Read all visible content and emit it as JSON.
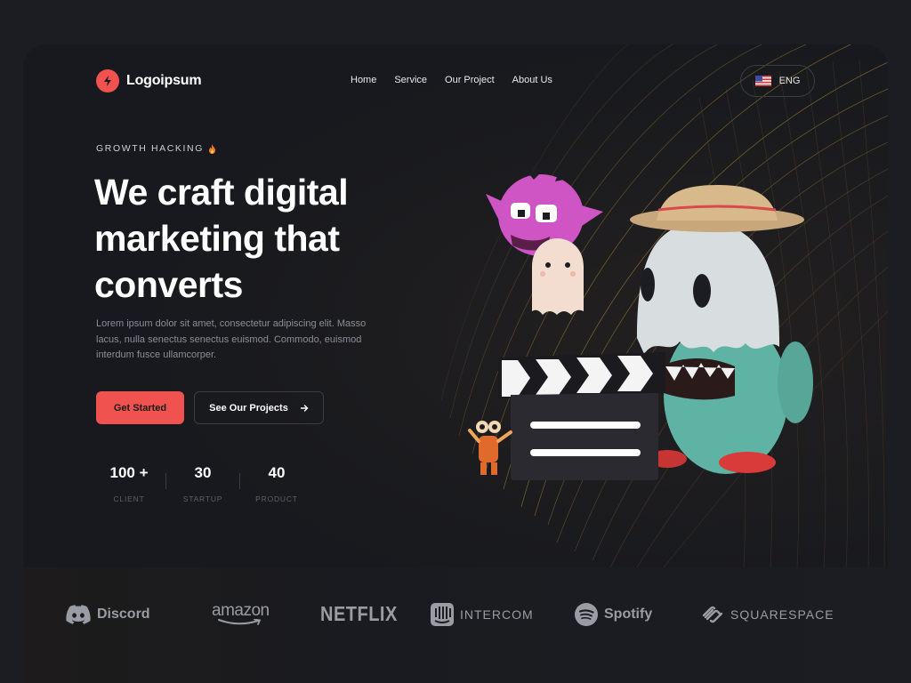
{
  "brand": {
    "name": "Logoipsum",
    "accent": "#f0524f"
  },
  "nav": {
    "items": [
      {
        "label": "Home"
      },
      {
        "label": "Service"
      },
      {
        "label": "Our Project"
      },
      {
        "label": "About Us"
      }
    ]
  },
  "language": {
    "label": "ENG",
    "icon": "us-flag-icon"
  },
  "hero": {
    "eyebrow": "GROWTH HACKING",
    "eyebrow_icon": "fire-icon",
    "headline_lines": [
      "We craft digital",
      "marketing that",
      "converts"
    ],
    "description": "Lorem ipsum dolor sit amet, consectetur adipiscing elit. Masso lacus, nulla senectus senectus euismod. Commodo, euismod interdum fusce ullamcorper.",
    "primary_button": "Get Started",
    "secondary_button": "See Our Projects",
    "secondary_icon": "arrow-right-icon"
  },
  "stats": [
    {
      "value": "100 +",
      "label": "CLIENT"
    },
    {
      "value": "30",
      "label": "STARTUP"
    },
    {
      "value": "40",
      "label": "PRODUCT"
    }
  ],
  "brands": [
    {
      "name": "Discord",
      "icon": "discord-icon"
    },
    {
      "name": "amazon",
      "icon": "amazon-smile-icon"
    },
    {
      "name": "NETFLIX",
      "icon": ""
    },
    {
      "name": "INTERCOM",
      "icon": "intercom-icon"
    },
    {
      "name": "Spotify",
      "icon": "spotify-icon"
    },
    {
      "name": "SQUARESPACE",
      "icon": "squarespace-icon"
    }
  ],
  "colors": {
    "background": "#1b1d22",
    "card": "#17191e",
    "text_muted": "#8b8e97",
    "brand_logo": "#9a9ca3"
  }
}
